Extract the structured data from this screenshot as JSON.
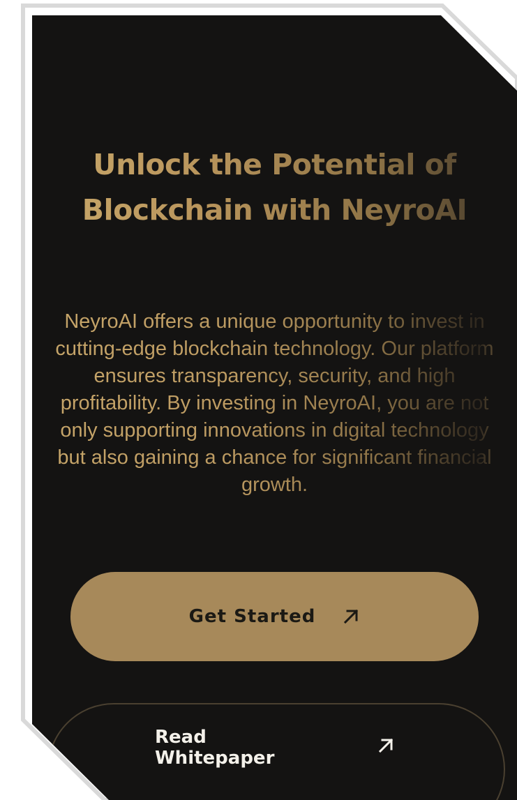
{
  "hero": {
    "title_line1": "Unlock the Potential of",
    "title_line2": "Blockchain with NeyroAI",
    "description": "NeyroAI offers a unique opportunity to invest in cutting-edge blockchain technology. Our platform ensures transparency, security, and high profitability. By investing in NeyroAI, you are not only supporting innovations in digital technology but also gaining a chance for significant financial growth."
  },
  "actions": {
    "primary_label": "Get Started",
    "primary_icon": "arrow-up-right-icon",
    "secondary_label": "Read Whitepaper",
    "secondary_icon": "arrow-up-right-icon"
  },
  "colors": {
    "card_background": "#141312",
    "accent_gold": "#a7895a",
    "text_gold": "#c7a66a",
    "button_text_dark": "#1b1914",
    "button_text_light": "#f4f1ea"
  }
}
